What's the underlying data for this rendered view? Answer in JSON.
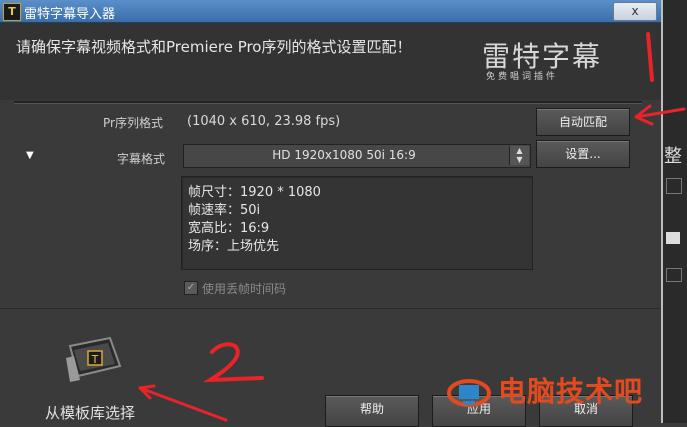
{
  "window": {
    "title": "雷特字幕导入器",
    "close_label": "x",
    "app_icon_letter": "T"
  },
  "header": {
    "instruction": "请确保字幕视频格式和Premiere Pro序列的格式设置匹配！",
    "logo_text": "雷特字幕",
    "logo_subtitle": "免费唱词插件"
  },
  "sequence": {
    "label": "Pr序列格式",
    "value": "(1040 x 610, 23.98 fps)",
    "auto_match_label": "自动匹配"
  },
  "subtitle_format": {
    "label": "字幕格式",
    "selected": "HD 1920x1080 50i 16:9",
    "settings_label": "设置..."
  },
  "info": {
    "lines": [
      "帧尺寸：1920 * 1080",
      "帧速率：50i",
      "宽高比：16:9",
      "场序：上场优先"
    ]
  },
  "dropframe": {
    "label": "使用丢帧时间码",
    "checked": true
  },
  "template": {
    "label": "从模板库选择"
  },
  "buttons": {
    "help": "帮助",
    "apply": "应用",
    "cancel": "取消"
  },
  "annotations": {
    "number_1": "1",
    "number_2": "2",
    "color": "#e8242a"
  },
  "background_app": {
    "side_char": "整"
  },
  "watermark": {
    "text": "电脑技术吧",
    "color": "#e44a1e"
  }
}
